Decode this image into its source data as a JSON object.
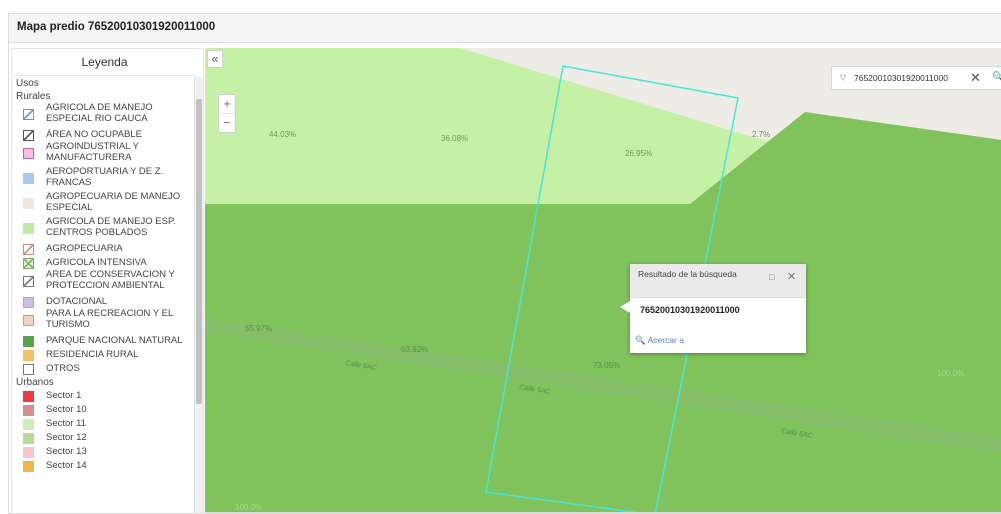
{
  "window": {
    "title": "Mapa predio 76520010301920011000"
  },
  "legend": {
    "title": "Leyenda",
    "root": "Usos",
    "groups": [
      {
        "label": "Rurales",
        "items": [
          {
            "label": "AGRICOLA DE MANEJO ESPECIAL RIO CAUCA",
            "fill": "#ffffff",
            "border": "#6f8fd1",
            "pattern": "diag"
          },
          {
            "label": "ÁREA NO OCUPABLE",
            "fill": "#ffffff",
            "border": "#555555",
            "pattern": "diag"
          },
          {
            "label": "AGROINDUSTRIAL Y MANUFACTURERA",
            "fill": "#f4bde6",
            "border": "#b26aa6",
            "pattern": "none"
          },
          {
            "label": "AEROPORTUARIA Y DE Z. FRANCAS",
            "fill": "#a9c9f2",
            "border": "#a9c9f2",
            "pattern": "none"
          },
          {
            "label": "AGROPECUARIA DE MANEJO ESPECIAL",
            "fill": "#f2e6dc",
            "border": "#f2e6dc",
            "pattern": "none"
          },
          {
            "label": "AGRICOLA DE MANEJO ESP. CENTROS POBLADOS",
            "fill": "#bfeaa6",
            "border": "#bfeaa6",
            "pattern": "none"
          },
          {
            "label": "AGROPECUARIA",
            "fill": "#ffffff",
            "border": "#c58b80",
            "pattern": "diag"
          },
          {
            "label": "AGRICOLA INTENSIVA",
            "fill": "#ddf3c9",
            "border": "#7fb06a",
            "pattern": "cross"
          },
          {
            "label": "AREA DE CONSERVACION Y PROTECCION AMBIENTAL",
            "fill": "#ffffff",
            "border": "#777777",
            "pattern": "diag"
          },
          {
            "label": "DOTACIONAL",
            "fill": "#cdbde3",
            "border": "#b5a2d2",
            "pattern": "none"
          },
          {
            "label": "PARA LA RECREACION Y EL TURISMO",
            "fill": "#f4d2bd",
            "border": "#c99b80",
            "pattern": "none"
          },
          {
            "label": "PARQUE NACIONAL NATURAL",
            "fill": "#58a34f",
            "border": "#58a34f",
            "pattern": "none"
          },
          {
            "label": "RESIDENCIA RURAL",
            "fill": "#f7c163",
            "border": "#f7c163",
            "pattern": "none"
          },
          {
            "label": "OTROS",
            "fill": "#ffffff",
            "border": "#777777",
            "pattern": "none"
          }
        ]
      },
      {
        "label": "Urbanos",
        "items": [
          {
            "label": "Sector 1",
            "fill": "#ef3b3b",
            "border": "#ef3b3b",
            "pattern": "none"
          },
          {
            "label": "Sector 10",
            "fill": "#d88d8d",
            "border": "#d88d8d",
            "pattern": "none"
          },
          {
            "label": "Sector 11",
            "fill": "#cdeeb5",
            "border": "#cdeeb5",
            "pattern": "none"
          },
          {
            "label": "Sector 12",
            "fill": "#b9d997",
            "border": "#b9d997",
            "pattern": "none"
          },
          {
            "label": "Sector 13",
            "fill": "#f8c7cc",
            "border": "#f8c7cc",
            "pattern": "none"
          },
          {
            "label": "Sector 14",
            "fill": "#f2b648",
            "border": "#f2b648",
            "pattern": "none"
          }
        ]
      }
    ]
  },
  "map": {
    "colors": {
      "light_green": "#c5f1a7",
      "dark_green": "#80c25c",
      "parcel_outline": "#47e6d6",
      "street_band": "#8bbd75",
      "background": "#eeece6"
    },
    "percent_labels": [
      "44.03%",
      "36.08%",
      "26.95%",
      "2.7%",
      "55.97%",
      "63.92%",
      "73.05%",
      "100.0%",
      "100.0%",
      "100.0%"
    ],
    "street_labels": [
      "Calle 5AC",
      "Calle 5AC",
      "Calle 5AC"
    ],
    "zoom_in": "+",
    "zoom_out": "−",
    "collapse_icon": "«"
  },
  "search": {
    "value": "76520010301920011000",
    "dropdown_icon": "▽",
    "clear_icon": "✕",
    "search_icon": "🔍"
  },
  "popup": {
    "title": "Resultado de la búsqueda",
    "value": "76520010301920011000",
    "zoom_label": "Acercar a",
    "maximize_icon": "□",
    "close_icon": "✕",
    "zoom_icon": "🔍"
  }
}
